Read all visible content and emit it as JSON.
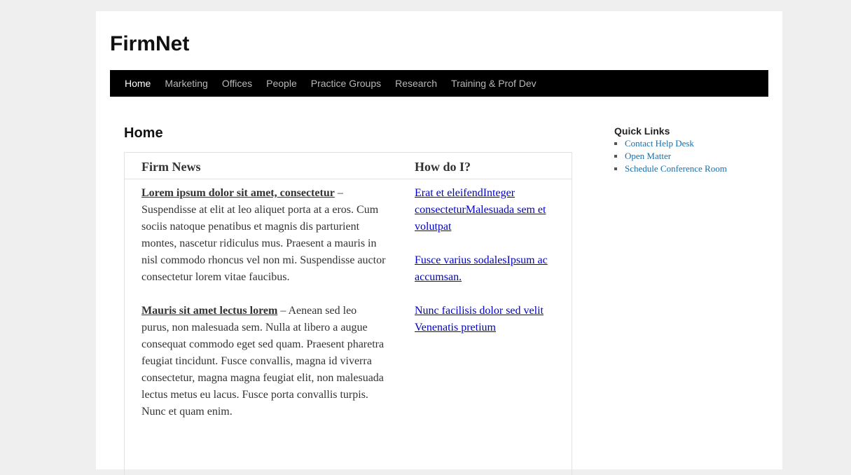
{
  "site": {
    "title": "FirmNet"
  },
  "nav": {
    "items": [
      {
        "label": "Home",
        "active": true
      },
      {
        "label": "Marketing"
      },
      {
        "label": "Offices"
      },
      {
        "label": "People"
      },
      {
        "label": "Practice Groups"
      },
      {
        "label": "Research"
      },
      {
        "label": "Training & Prof Dev"
      }
    ]
  },
  "main": {
    "page_title": "Home",
    "firm_news": {
      "heading": "Firm News",
      "items": [
        {
          "title": "Lorem ipsum dolor sit amet, consectetur",
          "body": " – Suspendisse at elit at leo aliquet porta at a eros. Cum sociis natoque penatibus et magnis dis parturient montes, nascetur ridiculus mus. Praesent a mauris in nisl commodo rhoncus vel non mi. Suspendisse auctor consectetur lorem vitae faucibus."
        },
        {
          "title": "Mauris sit amet lectus lorem",
          "body": " – Aenean sed leo purus, non malesuada sem. Nulla at libero a augue consequat commodo eget sed quam. Praesent pharetra feugiat tincidunt. Fusce convallis, magna id viverra consectetur, magna magna feugiat elit, non malesuada lectus metus eu lacus. Fusce porta convallis turpis. Nunc et quam enim."
        }
      ]
    },
    "how_do_i": {
      "heading": "How do I?",
      "links": [
        "Erat et eleifendInteger consecteturMalesuada sem et volutpat",
        "Fusce varius sodalesIpsum ac accumsan.",
        "Nunc facilisis dolor sed velit Venenatis pretium"
      ]
    }
  },
  "sidebar": {
    "heading": "Quick Links",
    "links": [
      "Contact Help Desk",
      "Open Matter",
      "Schedule Conference Room"
    ]
  }
}
